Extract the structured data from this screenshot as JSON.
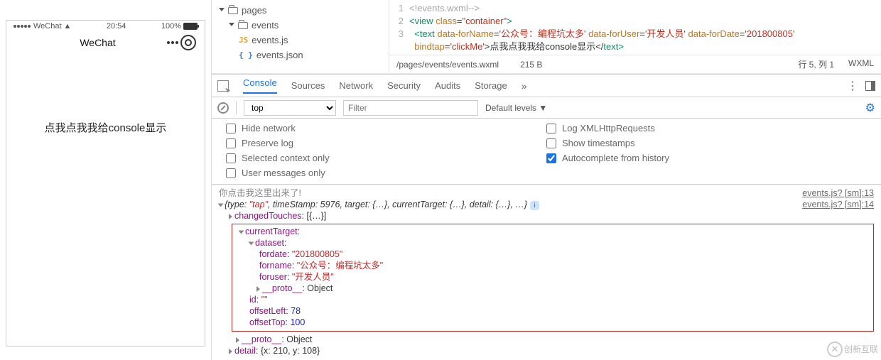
{
  "sim": {
    "carrier": "WeChat",
    "time": "20:54",
    "battery": "100%",
    "nav_title": "WeChat",
    "body_text": "点我点我我给console显示"
  },
  "tree": {
    "pages": "pages",
    "events_folder": "events",
    "events_js": "events.js",
    "events_json": "events.json",
    "js_badge": "JS",
    "json_badge": "{ }"
  },
  "code": {
    "line_nums": [
      "1",
      "2",
      "3"
    ],
    "l1_comment": "<!events.wxml-->",
    "l2_open": "<",
    "l2_tag": "view",
    "l2_attr": "class",
    "l2_eq": "=",
    "l2_val": "\"container\"",
    "l2_close": ">",
    "l3_open": "<",
    "l3_tag": "text",
    "l3_a1": "data-forName",
    "l3_v1": "'公众号：编程坑太多'",
    "l3_a2": "data-forUser",
    "l3_v2": "'开发人员'",
    "l3_a3": "data-forDate",
    "l3_v3": "'201800805'",
    "l3_a4": "bindtap",
    "l3_v4": "'clickMe'",
    "l3_txt": ">点我点我我给console显示</",
    "l3_tagc": "text",
    "l3_end": ">"
  },
  "status": {
    "path": "/pages/events/events.wxml",
    "size": "215 B",
    "pos": "行 5, 列 1",
    "lang": "WXML"
  },
  "devtabs": {
    "console": "Console",
    "sources": "Sources",
    "network": "Network",
    "security": "Security",
    "audits": "Audits",
    "storage": "Storage"
  },
  "toolbar": {
    "context": "top",
    "filter_ph": "Filter",
    "levels": "Default levels"
  },
  "opts": {
    "hide": "Hide network",
    "preserve": "Preserve log",
    "ctx": "Selected context only",
    "usr": "User messages only",
    "xhr": "Log XMLHttpRequests",
    "ts": "Show timestamps",
    "ac": "Autocomplete from history"
  },
  "console": {
    "msg1": "你点击我这里出来了!",
    "link1": "events.js? [sm]:13",
    "link2": "events.js? [sm]:14",
    "obj_head_pre": "{type: ",
    "obj_type": "\"tap\"",
    "obj_head_mid": ", timeStamp: 5976, target: {…}, currentTarget: {…}, detail: {…}, …}",
    "changedTouches": "changedTouches",
    "ct_val": ": [{…}]",
    "currentTarget": "currentTarget",
    "colon": ":",
    "dataset": "dataset",
    "fordate_k": "fordate",
    "fordate_v": "\"201800805\"",
    "forname_k": "forname",
    "forname_v": "\"公众号：编程坑太多\"",
    "foruser_k": "foruser",
    "foruser_v": "\"开发人员\"",
    "proto_k": "__proto__",
    "proto_v": ": Object",
    "id_k": "id",
    "id_v": "\"\"",
    "offL_k": "offsetLeft",
    "offL_v": "78",
    "offT_k": "offsetTop",
    "offT_v": "100",
    "detail_k": "detail",
    "detail_v": ": {x: 210, y: 108}"
  },
  "watermark": "创新互联"
}
